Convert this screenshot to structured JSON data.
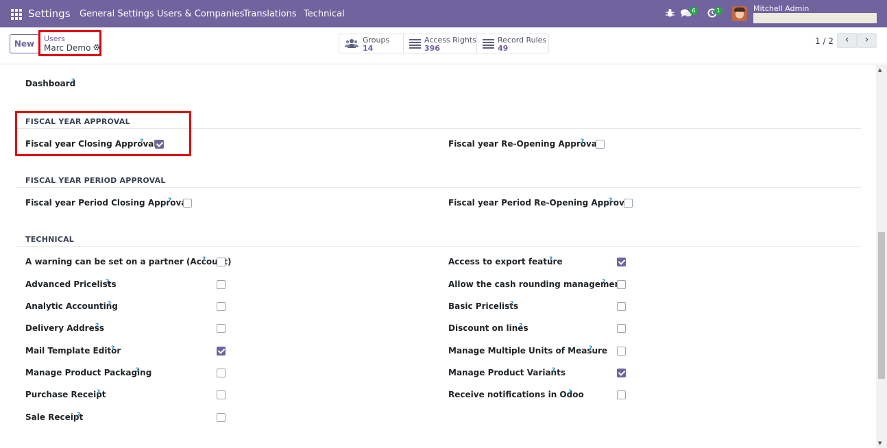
{
  "navbar": {
    "brand": "Settings",
    "menu": [
      "General Settings",
      "Users & Companies",
      "Translations",
      "Technical"
    ],
    "messages_count": "6",
    "activities_count": "1",
    "user_name": "Mitchell Admin"
  },
  "control_panel": {
    "new_label": "New",
    "breadcrumb": "Users",
    "record_name": "Marc Demo",
    "smart_buttons": [
      {
        "label": "Groups",
        "value": "14",
        "icon": "users-icon"
      },
      {
        "label": "Access Rights",
        "value": "396",
        "icon": "list-icon"
      },
      {
        "label": "Record Rules",
        "value": "49",
        "icon": "list-icon"
      }
    ],
    "pager": "1 / 2"
  },
  "content": {
    "dashboard_label": "Dashboard",
    "sections": {
      "fiscal_year": {
        "title": "FISCAL YEAR APPROVAL",
        "left": {
          "label": "Fiscal year Closing Approval",
          "checked": true
        },
        "right": {
          "label": "Fiscal year Re-Opening Approval",
          "checked": false
        }
      },
      "fiscal_period": {
        "title": "FISCAL YEAR PERIOD APPROVAL",
        "left": {
          "label": "Fiscal year Period Closing Approval",
          "checked": false
        },
        "right": {
          "label": "Fiscal year Period Re-Opening Approval",
          "checked": false
        }
      },
      "technical": {
        "title": "TECHNICAL",
        "left": [
          {
            "label": "A warning can be set on a partner (Account)",
            "checked": false
          },
          {
            "label": "Advanced Pricelists",
            "checked": false
          },
          {
            "label": "Analytic Accounting",
            "checked": false
          },
          {
            "label": "Delivery Address",
            "checked": false
          },
          {
            "label": "Mail Template Editor",
            "checked": true
          },
          {
            "label": "Manage Product Packaging",
            "checked": false
          },
          {
            "label": "Purchase Receipt",
            "checked": false
          },
          {
            "label": "Sale Receipt",
            "checked": false
          }
        ],
        "right": [
          {
            "label": "Access to export feature",
            "checked": true
          },
          {
            "label": "Allow the cash rounding management",
            "checked": false
          },
          {
            "label": "Basic Pricelists",
            "checked": false
          },
          {
            "label": "Discount on lines",
            "checked": false
          },
          {
            "label": "Manage Multiple Units of Measure",
            "checked": false
          },
          {
            "label": "Manage Product Variants",
            "checked": true
          },
          {
            "label": "Receive notifications in Odoo",
            "checked": false
          }
        ]
      }
    },
    "help_marker": "?"
  },
  "colors": {
    "navbar": "#71639e",
    "accent": "#71639e",
    "highlight": "#e3000b",
    "help": "#2b8fc1"
  }
}
